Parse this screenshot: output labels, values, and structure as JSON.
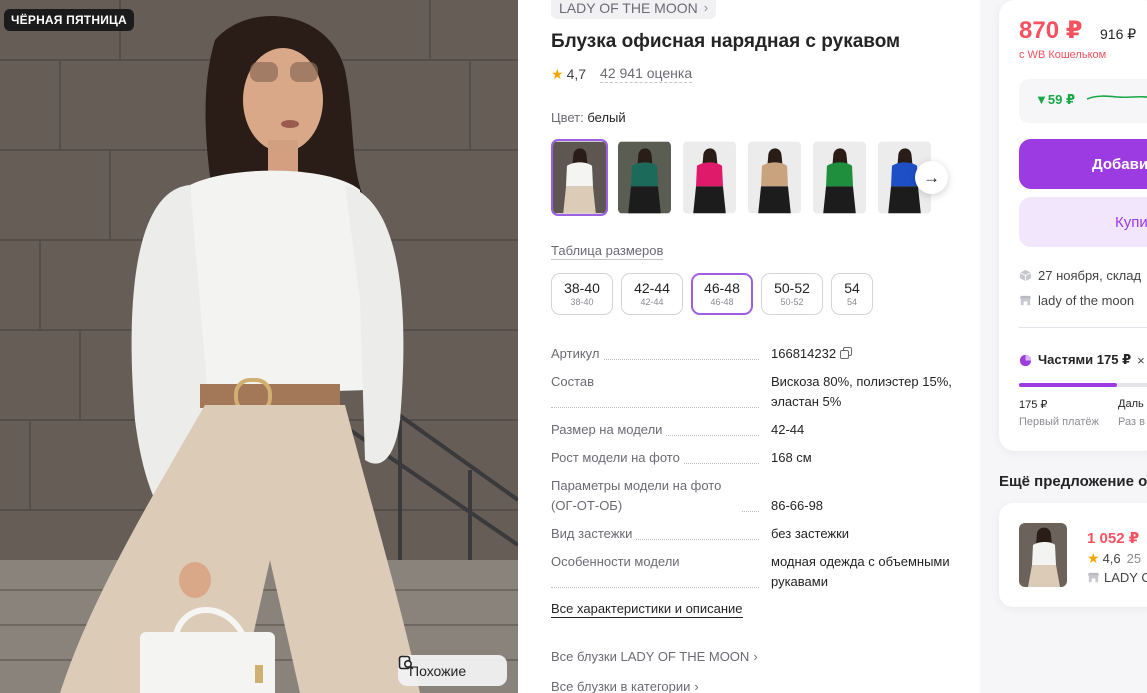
{
  "photo": {
    "badge": "ЧЁРНАЯ ПЯТНИЦА",
    "similar_label": "Похожие"
  },
  "product": {
    "brand": "LADY OF THE MOON",
    "title": "Блузка офисная нарядная с рукавом",
    "rating": "4,7",
    "reviews": "42 941 оценка",
    "color_label": "Цвет:",
    "color_value": "белый",
    "thumb_colors": [
      "#f4f4f2",
      "#1c6b5a",
      "#e01a6a",
      "#c9a27e",
      "#1f8f3e",
      "#1e4fc7"
    ],
    "size_table": "Таблица размеров",
    "sizes": [
      {
        "main": "38-40",
        "sub": "38-40"
      },
      {
        "main": "42-44",
        "sub": "42-44"
      },
      {
        "main": "46-48",
        "sub": "46-48",
        "selected": true
      },
      {
        "main": "50-52",
        "sub": "50-52"
      },
      {
        "main": "54",
        "sub": "54"
      }
    ],
    "specs": [
      {
        "key": "Артикул",
        "value": "166814232"
      },
      {
        "key": "Состав",
        "value": "Вискоза 80%, полиэстер 15%, эластан 5%"
      },
      {
        "key": "Размер на модели",
        "value": "42-44"
      },
      {
        "key": "Рост модели на фото",
        "value": "168 см"
      },
      {
        "key": "Параметры модели на фото (ОГ-ОТ-ОБ)",
        "value": "86-66-98"
      },
      {
        "key": "Вид застежки",
        "value": "без застежки"
      },
      {
        "key": "Особенности модели",
        "value": "модная одежда с объемными рукавами"
      }
    ],
    "all_specs": "Все характеристики и описание",
    "link_brand": "Все блузки LADY OF THE MOON",
    "link_category": "Все блузки в категории"
  },
  "buy": {
    "price": "870 ₽",
    "old_price": "916 ₽",
    "wallet": "с WB Кошельком",
    "trend_value": "▼59 ₽",
    "add_button": "Добави",
    "buy_button": "Купи",
    "delivery": "27 ноября, склад",
    "seller": "lady of the moon",
    "parts_label": "Частями 175 ₽",
    "parts_x": "×",
    "parts_progress": 0.7,
    "first_value": "175 ₽",
    "first_label": "Первый платёж",
    "next_value": "Даль",
    "next_label": "Раз в"
  },
  "more": {
    "title": "Ещё предложение о",
    "price": "1 052 ₽",
    "rating": "4,6",
    "count": "25",
    "seller": "LADY O"
  },
  "colors": {
    "accent": "#9d3be3",
    "price_red": "#f5515f",
    "trend_green": "#18a846"
  }
}
